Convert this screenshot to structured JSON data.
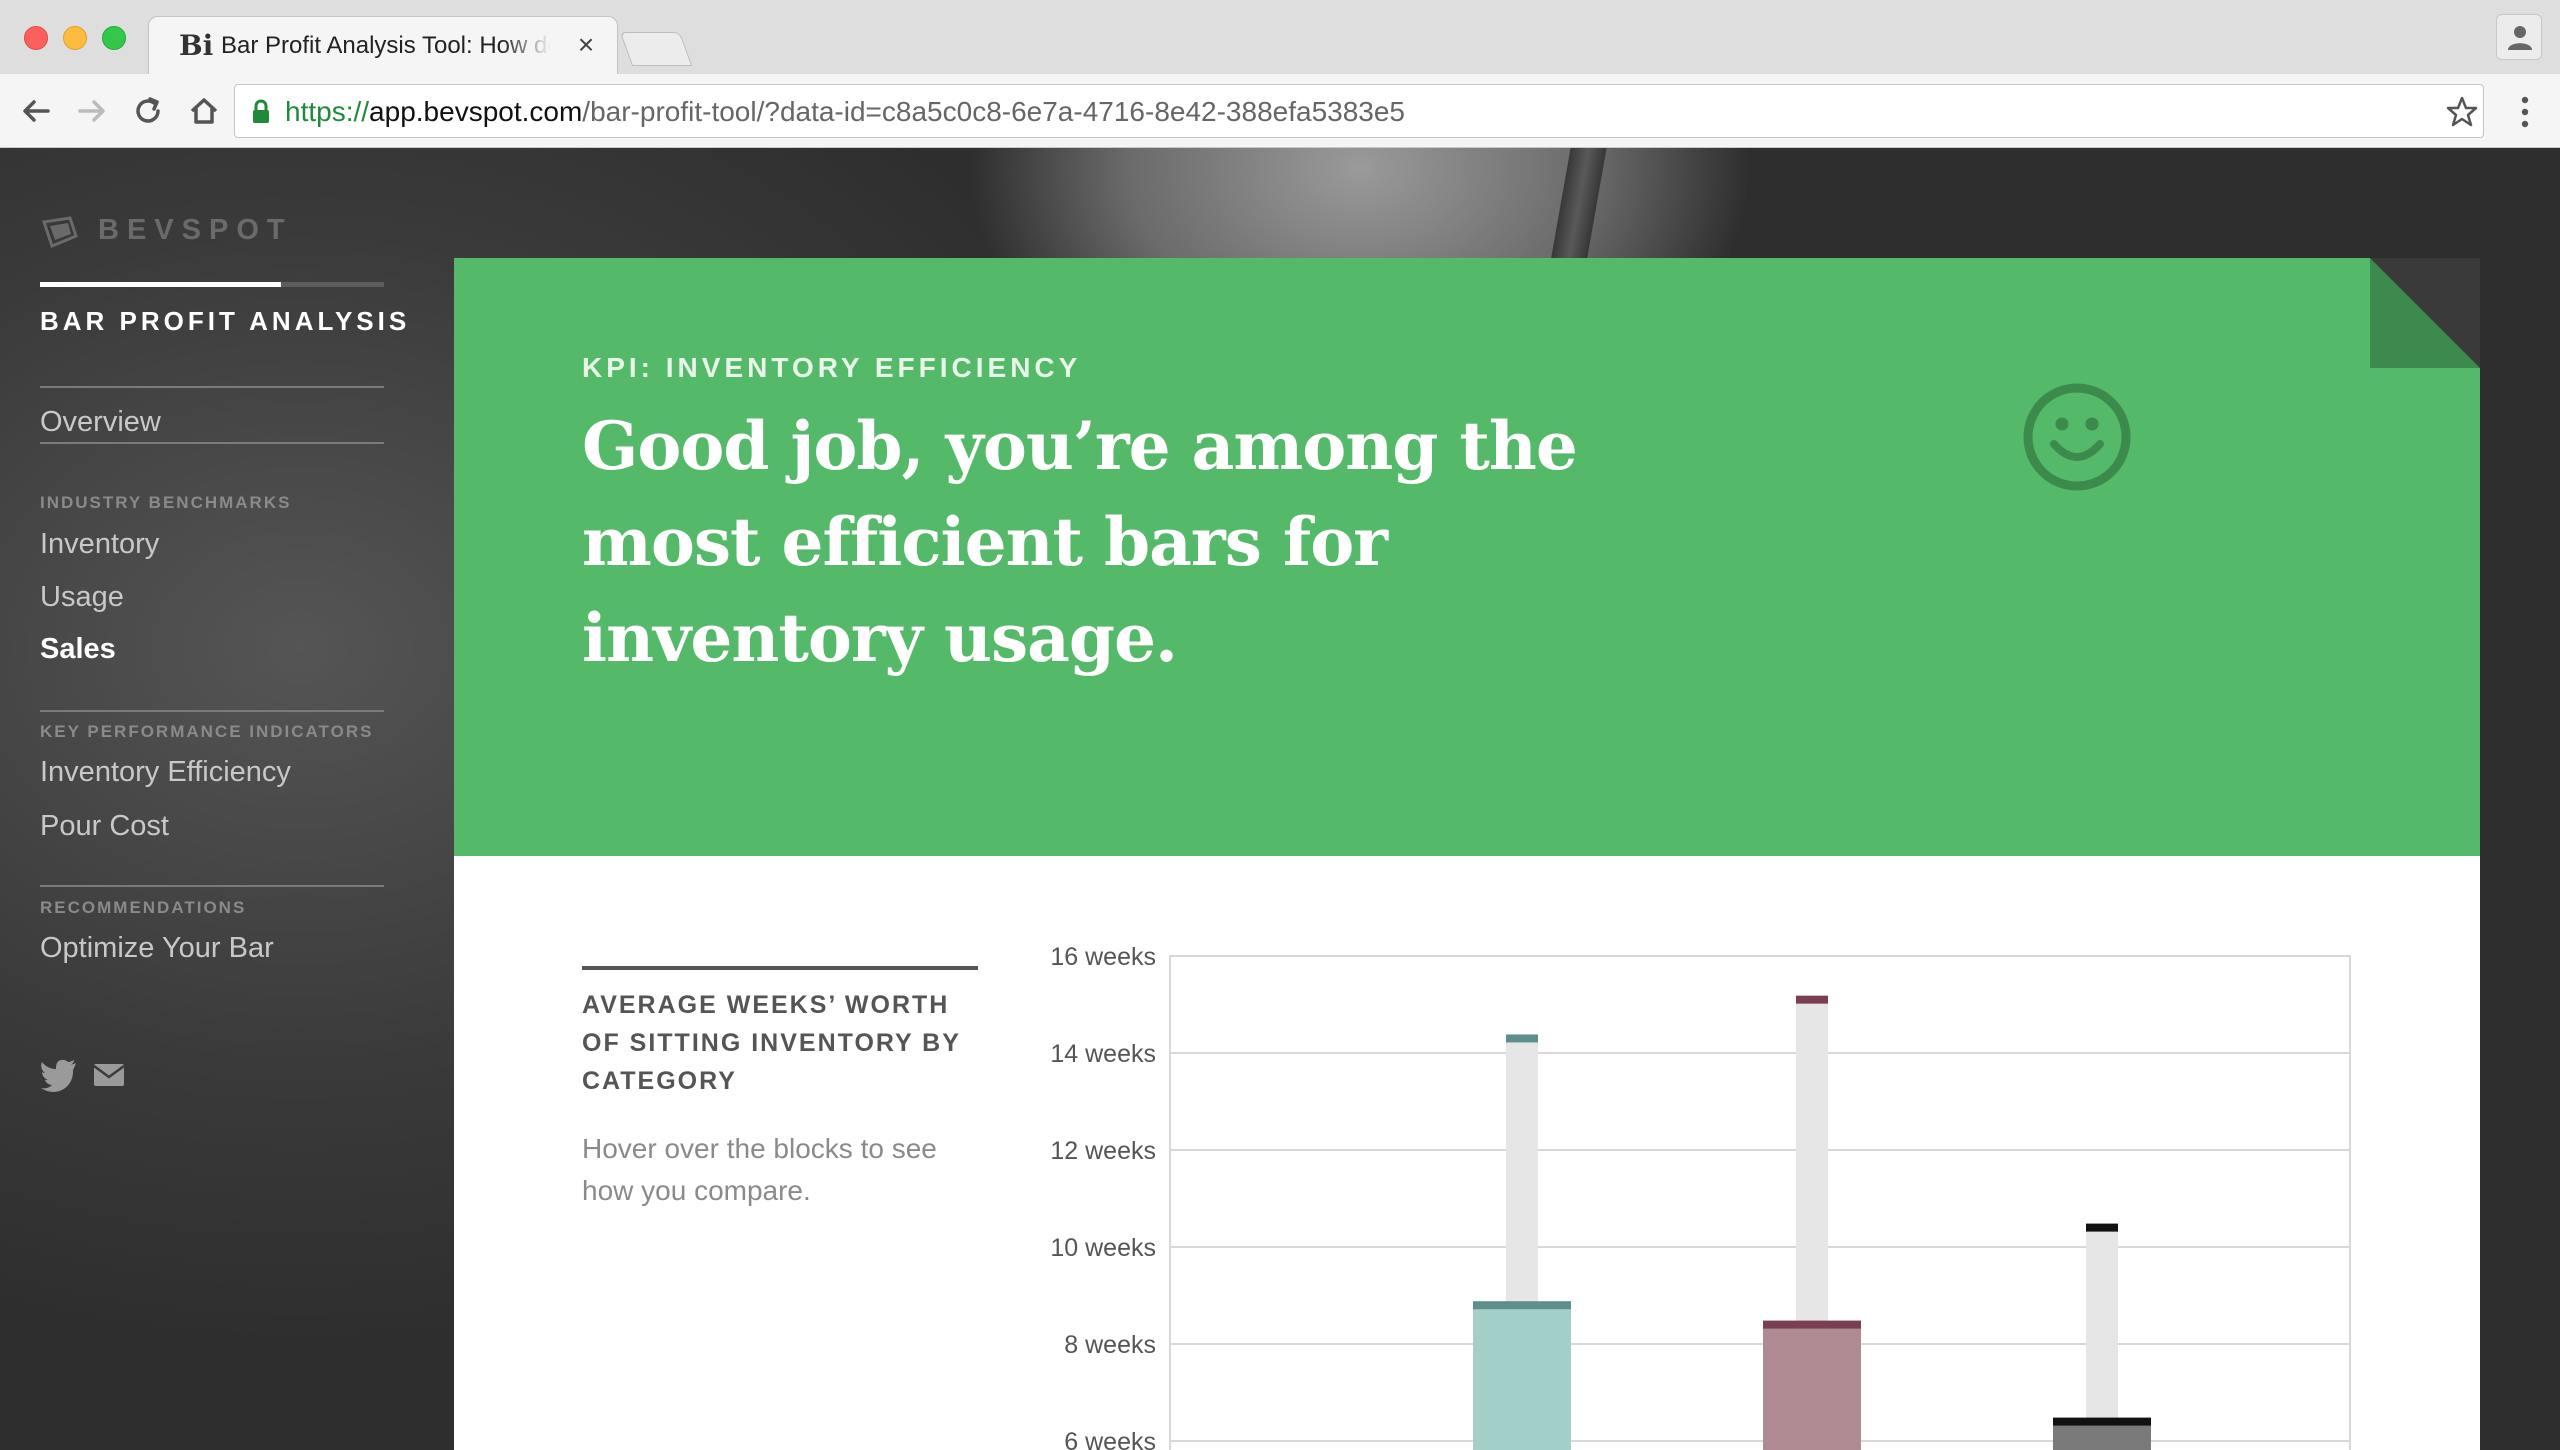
{
  "browser": {
    "tab_title": "Bar Profit Analysis Tool: How do",
    "tab_favicon": "Bi",
    "url": {
      "scheme": "https://",
      "host": "app.bevspot.com",
      "path": "/bar-profit-tool/?data-id=c8a5c0c8-6e7a-4716-8e42-388efa5383e5"
    }
  },
  "sidebar": {
    "brand": "BEVSPOT",
    "section_title": "BAR PROFIT ANALYSIS",
    "progress_fraction": 0.7,
    "overview": "Overview",
    "groups": [
      {
        "label": "INDUSTRY BENCHMARKS",
        "items": [
          "Inventory",
          "Usage",
          "Sales"
        ]
      },
      {
        "label": "KEY PERFORMANCE INDICATORS",
        "items": [
          "Inventory Efficiency",
          "Pour Cost"
        ]
      },
      {
        "label": "RECOMMENDATIONS",
        "items": [
          "Optimize Your Bar"
        ]
      }
    ],
    "active_item": "Sales"
  },
  "hero": {
    "kpi_label": "KPI: INVENTORY EFFICIENCY",
    "headline": "Good job, you’re among the most efficient bars for inventory usage.",
    "background_color": "#55b96a",
    "icon": "smiley-face-icon"
  },
  "chart_section": {
    "title": "AVERAGE WEEKS’ WORTH OF SITTING INVENTORY BY CATEGORY",
    "hint": "Hover over the blocks to see how you compare."
  },
  "chart_data": {
    "type": "bar",
    "ylabel": "",
    "xlabel": "",
    "yticks": [
      "6 weeks",
      "8 weeks",
      "10 weeks",
      "12 weeks",
      "14 weeks",
      "16 weeks"
    ],
    "ylim": [
      6,
      16
    ],
    "grid": true,
    "series": [
      {
        "top_marker": 14.3,
        "block_top": 8.8,
        "block_bottom": 6,
        "color": "#a3cfc9",
        "marker_color": "#5e8f8c"
      },
      {
        "top_marker": 15.1,
        "block_top": 8.4,
        "block_bottom": 6,
        "color": "#b08a93",
        "marker_color": "#7a3e55"
      },
      {
        "top_marker": 10.4,
        "block_top": 6.4,
        "block_bottom": 6,
        "color": "#7a7a7a",
        "marker_color": "#111111"
      }
    ]
  }
}
